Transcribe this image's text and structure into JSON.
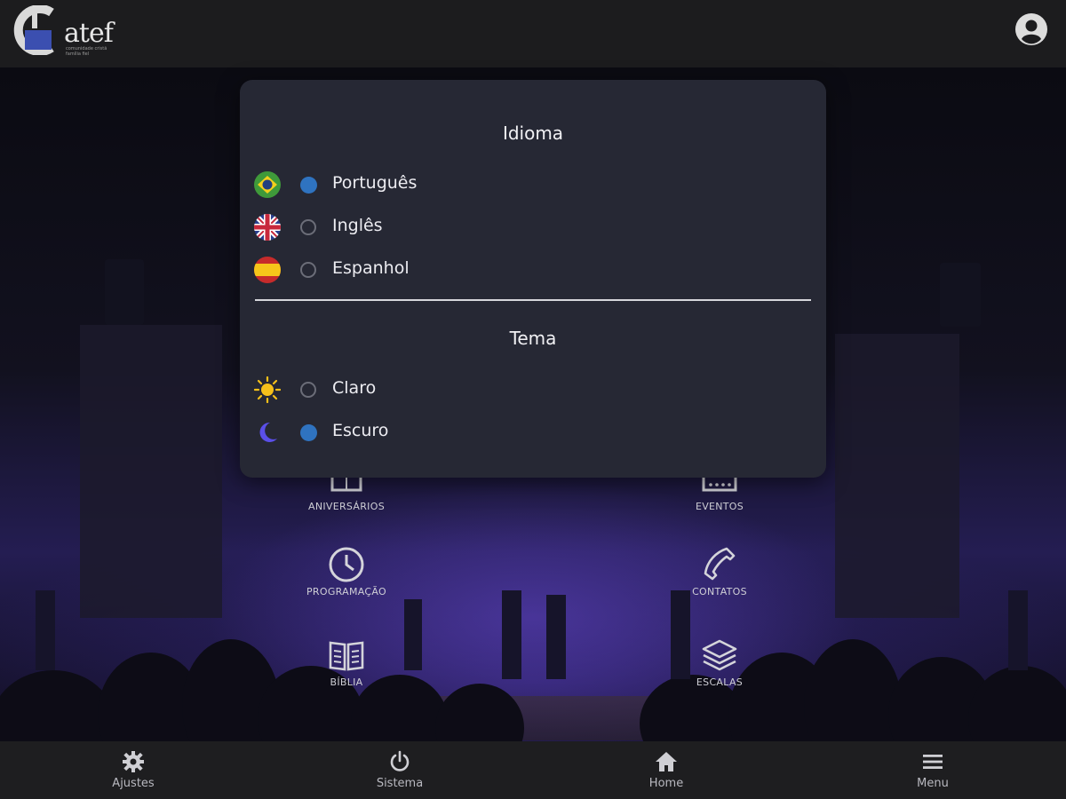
{
  "header": {
    "logo_text": "atef",
    "logo_subtitle": "comunidade cristã família fiel"
  },
  "settings": {
    "language": {
      "title": "Idioma",
      "options": [
        {
          "label": "Português",
          "icon": "brazil-flag-icon",
          "selected": true
        },
        {
          "label": "Inglês",
          "icon": "uk-flag-icon",
          "selected": false
        },
        {
          "label": "Espanhol",
          "icon": "spain-flag-icon",
          "selected": false
        }
      ]
    },
    "theme": {
      "title": "Tema",
      "options": [
        {
          "label": "Claro",
          "icon": "sun-icon",
          "selected": false
        },
        {
          "label": "Escuro",
          "icon": "moon-icon",
          "selected": true
        }
      ]
    }
  },
  "menu": {
    "items": [
      {
        "label": "ANIVERSÁRIOS",
        "icon": "calendar-icon"
      },
      {
        "label": "EVENTOS",
        "icon": "calendar-icon"
      },
      {
        "label": "PROGRAMAÇÃO",
        "icon": "clock-icon"
      },
      {
        "label": "CONTATOS",
        "icon": "phone-icon"
      },
      {
        "label": "BÍBLIA",
        "icon": "book-icon"
      },
      {
        "label": "ESCALAS",
        "icon": "layers-icon"
      }
    ]
  },
  "bottom_nav": {
    "items": [
      {
        "label": "Ajustes",
        "icon": "gear-icon"
      },
      {
        "label": "Sistema",
        "icon": "power-icon"
      },
      {
        "label": "Home",
        "icon": "home-icon"
      },
      {
        "label": "Menu",
        "icon": "hamburger-icon"
      }
    ]
  },
  "colors": {
    "accent_radio": "#2f73c0",
    "modal_bg": "#262834",
    "bar_bg": "#1e1e20"
  }
}
